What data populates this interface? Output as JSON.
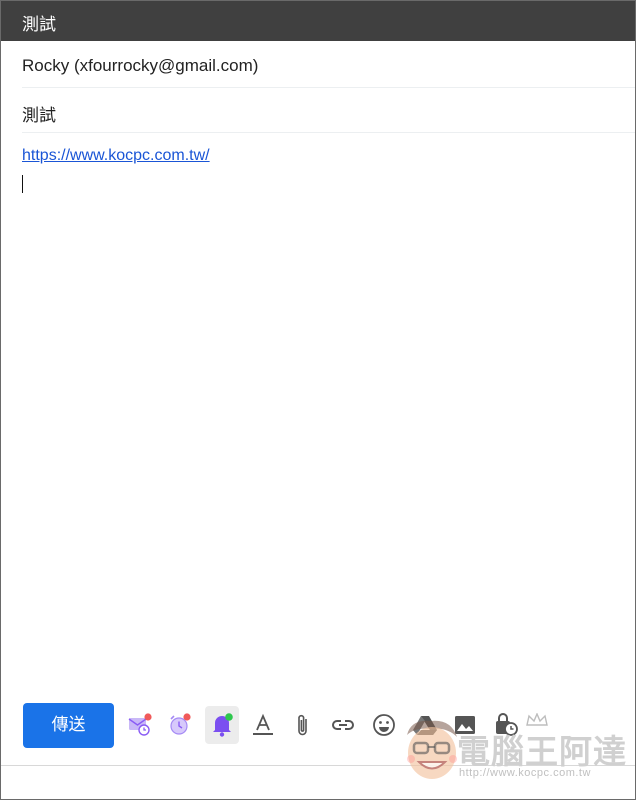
{
  "window": {
    "title": "測試"
  },
  "compose": {
    "recipients": "Rocky (xfourrocky@gmail.com)",
    "subject": "測試",
    "body_link": "https://www.kocpc.com.tw/"
  },
  "toolbar": {
    "send_label": "傳送",
    "icons": [
      "schedule-mail-icon",
      "snooze-alarm-icon",
      "bell-icon",
      "format-text-icon",
      "attach-icon",
      "link-icon",
      "emoji-icon",
      "drive-icon",
      "photo-icon",
      "confidential-mode-icon"
    ]
  },
  "watermark": {
    "text": "電腦王阿達",
    "url": "http://www.kocpc.com.tw"
  },
  "colors": {
    "titlebar": "#404040",
    "send_button": "#1a73e8",
    "link": "#1a55d6",
    "accent_purple": "#8a5cf5",
    "badge_red": "#f05a5a",
    "badge_green": "#2ec74e"
  }
}
